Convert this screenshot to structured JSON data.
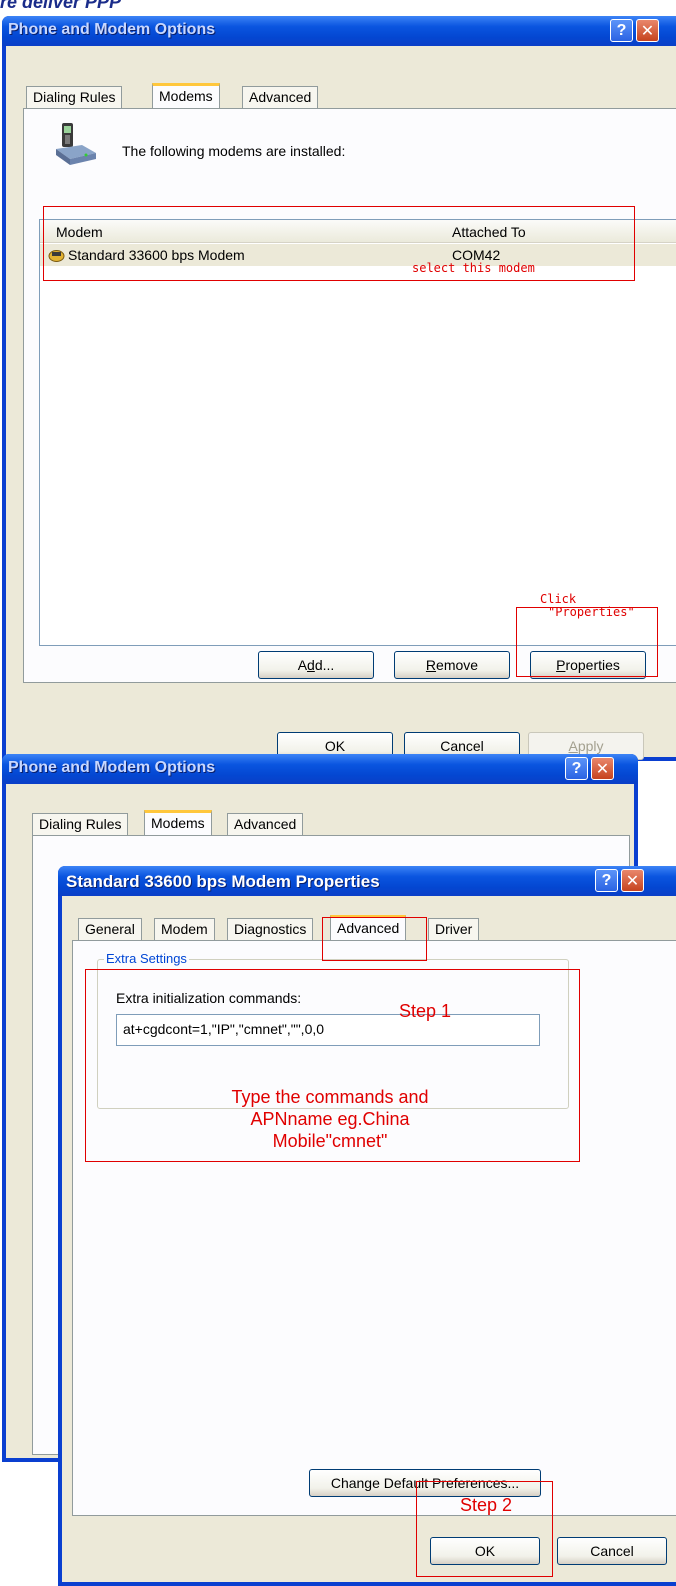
{
  "heading_fragment": "re deliver PPP",
  "dialog1": {
    "title": "Phone and Modem Options",
    "tabs": [
      "Dialing Rules",
      "Modems",
      "Advanced"
    ],
    "description": "The following modems are installed:",
    "columns": [
      "Modem",
      "Attached To"
    ],
    "modem": {
      "name": "Standard 33600 bps Modem",
      "port": "COM42"
    },
    "buttons": {
      "add": "Add...",
      "remove": "Remove",
      "properties": "Properties"
    },
    "footer": {
      "ok": "OK",
      "cancel": "Cancel",
      "apply": "Apply"
    },
    "annotations": {
      "select": "select this modem",
      "click_line1": "Click",
      "click_line2": "\"Properties\""
    }
  },
  "dialog2": {
    "title": "Phone and Modem Options",
    "tabs": [
      "Dialing Rules",
      "Modems",
      "Advanced"
    ]
  },
  "dialog3": {
    "title": "Standard 33600 bps Modem Properties",
    "tabs": [
      "General",
      "Modem",
      "Diagnostics",
      "Advanced",
      "Driver"
    ],
    "group_label": "Extra Settings",
    "field_label": "Extra initialization commands:",
    "field_value": "at+cgdcont=1,\"IP\",\"cmnet\",\"\",0,0",
    "change_button": "Change Default Preferences...",
    "ok": "OK",
    "cancel": "Cancel",
    "annotations": {
      "step1": "Step 1",
      "instruction": "Type the commands and APNname  eg.China Mobile\"cmnet\"",
      "step2": "Step 2"
    }
  }
}
